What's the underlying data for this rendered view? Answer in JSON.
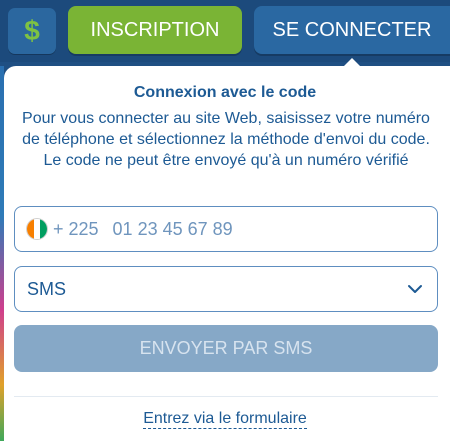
{
  "header": {
    "currency_icon": "dollar-icon",
    "currency_symbol": "$",
    "register_label": "INSCRIPTION",
    "login_label": "SE CONNECTER"
  },
  "login_panel": {
    "title": "Connexion avec le code",
    "description": "Pour vous connecter au site Web, saisissez votre numéro de téléphone et sélectionnez la méthode d'envoi du code. Le code ne peut être envoyé qu'à un numéro vérifié",
    "phone": {
      "country_flag_icon": "cote-divoire-flag-icon",
      "country_code": "+ 225",
      "placeholder": "01 23 45 67 89"
    },
    "method_select": {
      "selected": "SMS",
      "icon": "chevron-down-icon"
    },
    "send_button_label": "ENVOYER PAR SMS",
    "form_link_label": "Entrez via le formulaire"
  },
  "colors": {
    "header_bg": "#1c4a7c",
    "register_green": "#7ab435",
    "login_blue": "#2a68a2",
    "text_blue": "#1d5a94",
    "disabled_button": "#86a8c7"
  }
}
